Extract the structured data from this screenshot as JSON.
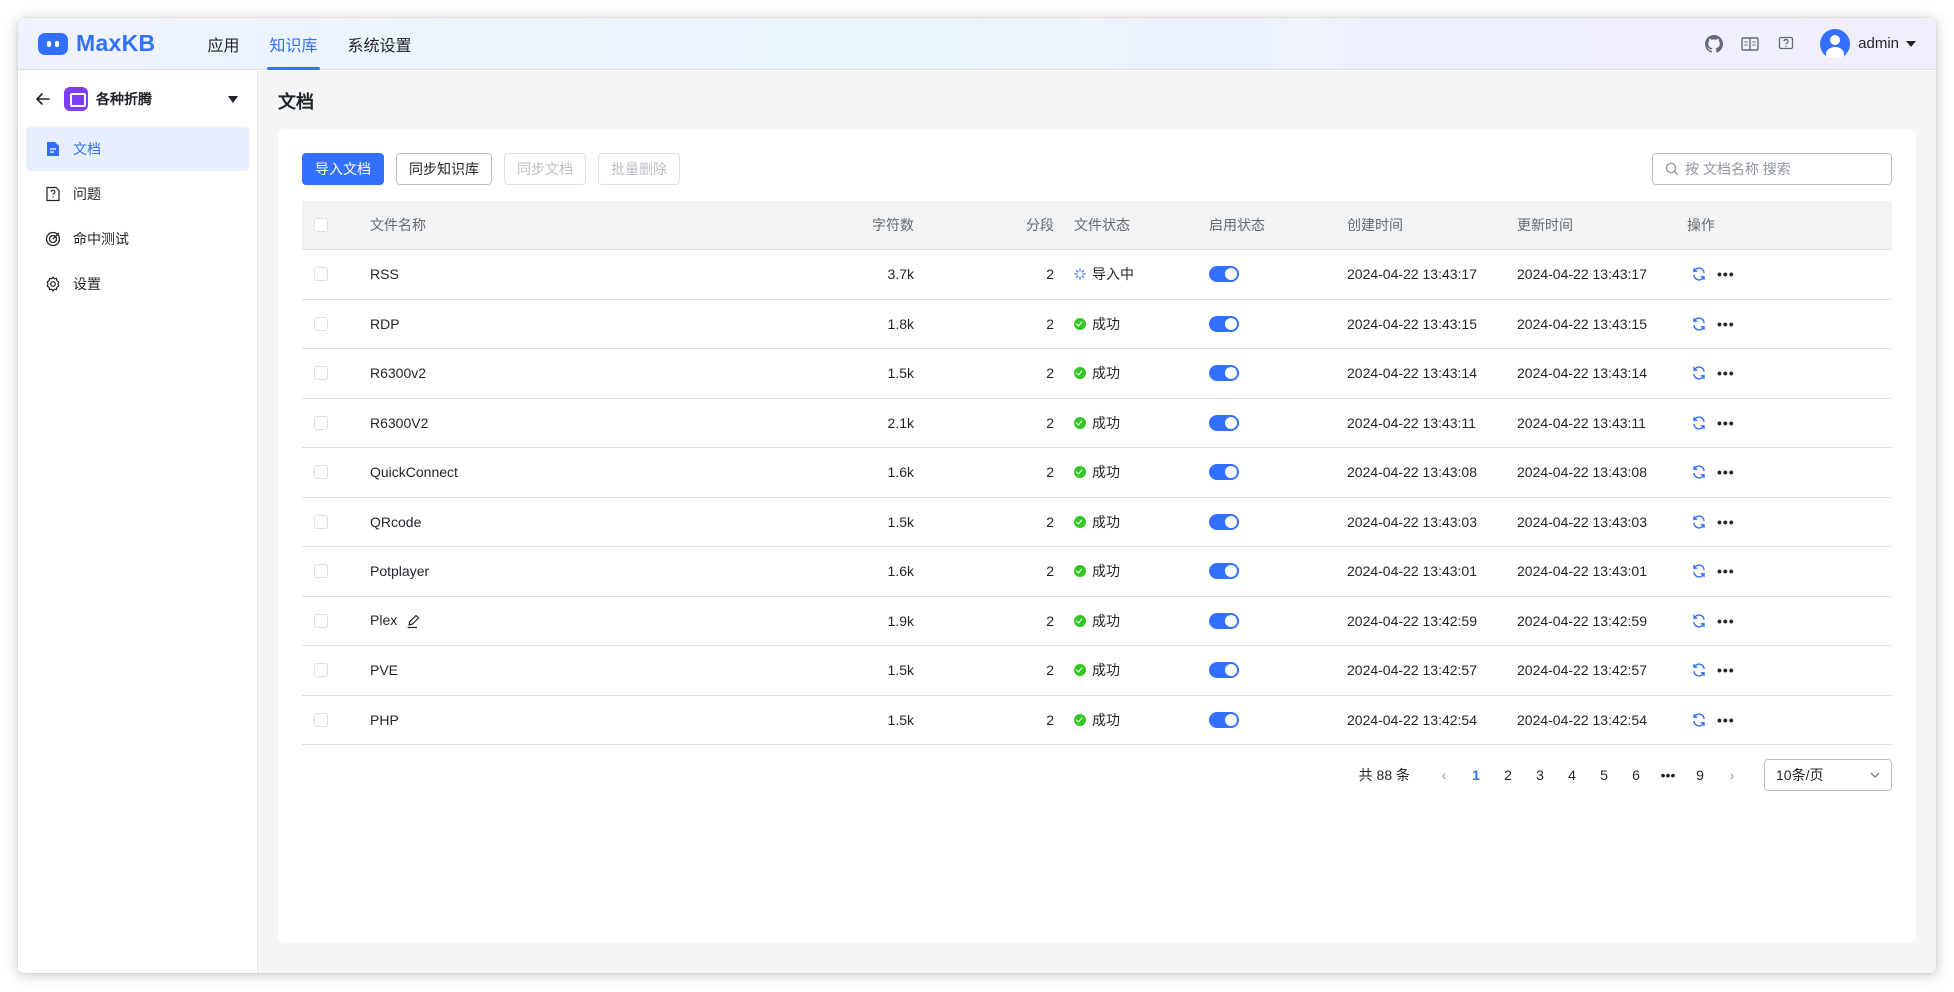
{
  "app": {
    "logo_text": "MaxKB",
    "accent_color": "#3370ff"
  },
  "topnav": {
    "items": [
      "应用",
      "知识库",
      "系统设置"
    ],
    "active": "知识库"
  },
  "user": {
    "name": "admin"
  },
  "sidebar": {
    "kb_name": "各种折腾",
    "items": [
      {
        "label": "文档",
        "icon": "document-icon",
        "active": true
      },
      {
        "label": "问题",
        "icon": "question-icon",
        "active": false
      },
      {
        "label": "命中测试",
        "icon": "target-icon",
        "active": false
      },
      {
        "label": "设置",
        "icon": "gear-icon",
        "active": false
      }
    ]
  },
  "page": {
    "title": "文档"
  },
  "toolbar": {
    "import_label": "导入文档",
    "sync_kb_label": "同步知识库",
    "sync_doc_label": "同步文档",
    "batch_delete_label": "批量删除",
    "search_placeholder": "按 文档名称 搜索"
  },
  "table": {
    "headers": {
      "name": "文件名称",
      "chars": "字符数",
      "segments": "分段",
      "file_status": "文件状态",
      "enabled": "启用状态",
      "created": "创建时间",
      "updated": "更新时间",
      "ops": "操作"
    },
    "rows": [
      {
        "name": "RSS",
        "chars": "3.7k",
        "segments": "2",
        "status": "导入中",
        "status_type": "loading",
        "enabled": true,
        "created": "2024-04-22 13:43:17",
        "updated": "2024-04-22 13:43:17"
      },
      {
        "name": "RDP",
        "chars": "1.8k",
        "segments": "2",
        "status": "成功",
        "status_type": "success",
        "enabled": true,
        "created": "2024-04-22 13:43:15",
        "updated": "2024-04-22 13:43:15"
      },
      {
        "name": "R6300v2",
        "chars": "1.5k",
        "segments": "2",
        "status": "成功",
        "status_type": "success",
        "enabled": true,
        "created": "2024-04-22 13:43:14",
        "updated": "2024-04-22 13:43:14"
      },
      {
        "name": "R6300V2",
        "chars": "2.1k",
        "segments": "2",
        "status": "成功",
        "status_type": "success",
        "enabled": true,
        "created": "2024-04-22 13:43:11",
        "updated": "2024-04-22 13:43:11"
      },
      {
        "name": "QuickConnect",
        "chars": "1.6k",
        "segments": "2",
        "status": "成功",
        "status_type": "success",
        "enabled": true,
        "created": "2024-04-22 13:43:08",
        "updated": "2024-04-22 13:43:08"
      },
      {
        "name": "QRcode",
        "chars": "1.5k",
        "segments": "2",
        "status": "成功",
        "status_type": "success",
        "enabled": true,
        "created": "2024-04-22 13:43:03",
        "updated": "2024-04-22 13:43:03"
      },
      {
        "name": "Potplayer",
        "chars": "1.6k",
        "segments": "2",
        "status": "成功",
        "status_type": "success",
        "enabled": true,
        "created": "2024-04-22 13:43:01",
        "updated": "2024-04-22 13:43:01"
      },
      {
        "name": "Plex",
        "chars": "1.9k",
        "segments": "2",
        "status": "成功",
        "status_type": "success",
        "enabled": true,
        "created": "2024-04-22 13:42:59",
        "updated": "2024-04-22 13:42:59",
        "edit_icon": true
      },
      {
        "name": "PVE",
        "chars": "1.5k",
        "segments": "2",
        "status": "成功",
        "status_type": "success",
        "enabled": true,
        "created": "2024-04-22 13:42:57",
        "updated": "2024-04-22 13:42:57"
      },
      {
        "name": "PHP",
        "chars": "1.5k",
        "segments": "2",
        "status": "成功",
        "status_type": "success",
        "enabled": true,
        "created": "2024-04-22 13:42:54",
        "updated": "2024-04-22 13:42:54"
      }
    ]
  },
  "pagination": {
    "total_label": "共 88 条",
    "pages": [
      "1",
      "2",
      "3",
      "4",
      "5",
      "6",
      "•••",
      "9"
    ],
    "current": "1",
    "page_size": "10条/页"
  }
}
